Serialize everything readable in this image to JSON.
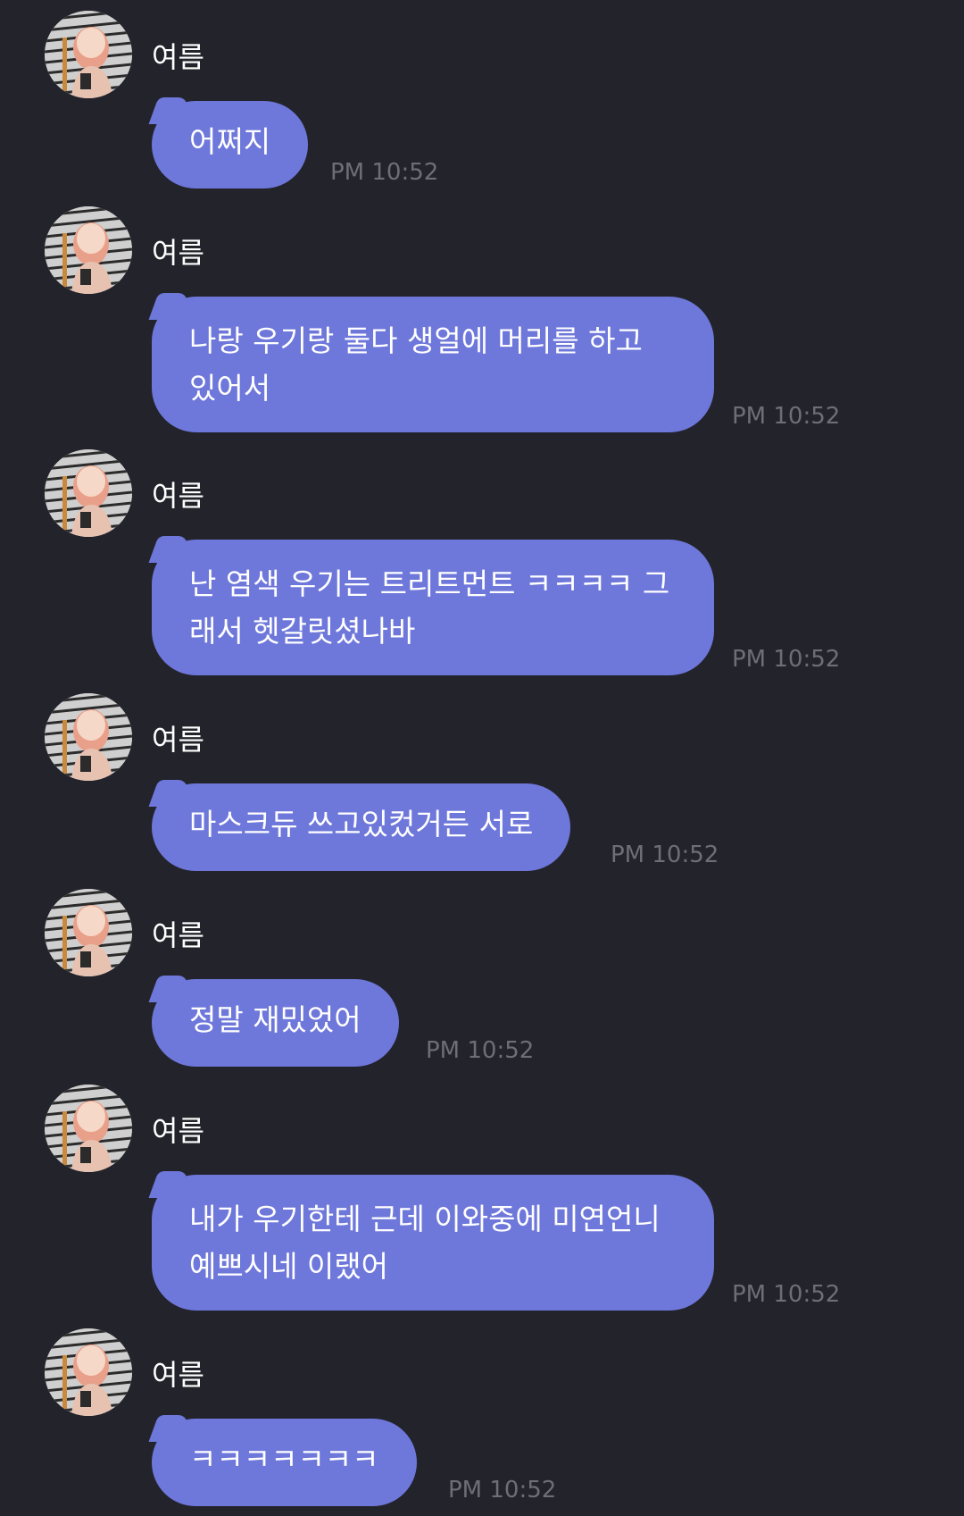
{
  "sender_name": "여름",
  "messages": [
    {
      "text": "어쩌지",
      "time": "PM 10:52"
    },
    {
      "text": "나랑 우기랑 둘다 생얼에 머리를 하고 있어서",
      "time": "PM 10:52"
    },
    {
      "text": "난 염색 우기는 트리트먼트 ㅋㅋㅋㅋ 그래서 헷갈릿셨나바",
      "time": "PM 10:52"
    },
    {
      "text": "마스크듀 쓰고있컸거든 서로",
      "time": "PM 10:52"
    },
    {
      "text": "정말 재밌었어",
      "time": "PM 10:52"
    },
    {
      "text": "내가 우기한테 근데 이와중에 미연언니 예쁘시네 이랬어",
      "time": "PM 10:52"
    },
    {
      "text": "ㅋㅋㅋㅋㅋㅋㅋ",
      "time": "PM 10:52"
    }
  ],
  "colors": {
    "background": "#23232b",
    "bubble": "#6e77da",
    "timestamp": "#6e6e78",
    "text": "#ffffff"
  },
  "icons": {
    "avatar": "profile-photo"
  }
}
